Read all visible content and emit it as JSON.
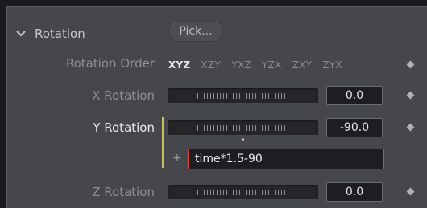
{
  "section": {
    "title": "Rotation",
    "pick_label": "Pick..."
  },
  "rotation_order": {
    "label": "Rotation Order",
    "options": [
      "XYZ",
      "XZY",
      "YXZ",
      "YZX",
      "ZXY",
      "ZYX"
    ],
    "selected": "XYZ"
  },
  "x_rotation": {
    "label": "X Rotation",
    "value": "0.0"
  },
  "y_rotation": {
    "label": "Y Rotation",
    "value": "-90.0",
    "expression_prefix": "+",
    "expression": "time*1.5-90"
  },
  "z_rotation": {
    "label": "Z Rotation",
    "value": "0.0"
  },
  "colors": {
    "panel": "#46474b",
    "error_border": "#d6484a",
    "focus_bar": "#c9c060"
  }
}
